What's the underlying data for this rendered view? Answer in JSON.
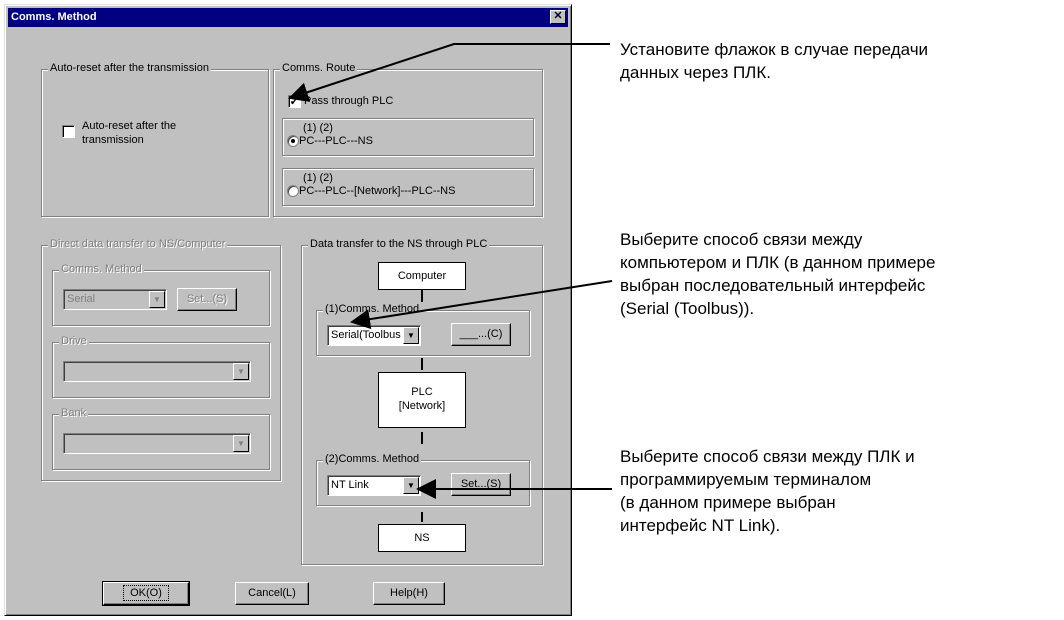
{
  "window": {
    "title": "Comms. Method",
    "close_label": "✕"
  },
  "auto_reset": {
    "group_label": "Auto-reset after the transmission",
    "checkbox_label_line1": "Auto-reset after the",
    "checkbox_label_line2": "transmission",
    "checked": false
  },
  "comms_route": {
    "group_label": "Comms. Route",
    "pass_through_label": "Pass through PLC",
    "pass_through_checked": true,
    "options": [
      {
        "line1": "(1)     (2)",
        "line2": "PC---PLC---NS",
        "selected": true
      },
      {
        "line1": "(1)                              (2)",
        "line2": "PC---PLC--[Network]---PLC--NS",
        "selected": false
      }
    ]
  },
  "direct_transfer": {
    "group_label": "Direct data transfer to NS/Computer",
    "comms_method_label": "Comms. Method",
    "comms_method_value": "Serial",
    "set_button": "Set...(S)",
    "drive_label": "Drive",
    "bank_label": "Bank"
  },
  "plc_transfer": {
    "group_label": "Data transfer to the NS through PLC",
    "computer_box": "Computer",
    "method1_label": "(1)Comms. Method",
    "method1_value": "Serial(Toolbus",
    "method1_button": "___...(C)",
    "plc_box_line1": "PLC",
    "plc_box_line2": "[Network]",
    "method2_label": "(2)Comms. Method",
    "method2_value": "NT Link",
    "method2_button": "Set...(S)",
    "ns_box": "NS"
  },
  "buttons": {
    "ok": "OK(O)",
    "cancel": "Cancel(L)",
    "help": "Help(H)"
  },
  "annotations": [
    {
      "line1": "Установите флажок в случае передачи",
      "line2": "данных через ПЛК."
    },
    {
      "line1": "Выберите способ связи между",
      "line2": "компьютером и ПЛК (в данном примере",
      "line3": "выбран последовательный интерфейс",
      "line4": "(Serial (Toolbus))."
    },
    {
      "line1": "Выберите способ связи между ПЛК и",
      "line2": "программируемым терминалом",
      "line3": "(в данном примере выбран",
      "line4": "интерфейс NT Link)."
    }
  ]
}
